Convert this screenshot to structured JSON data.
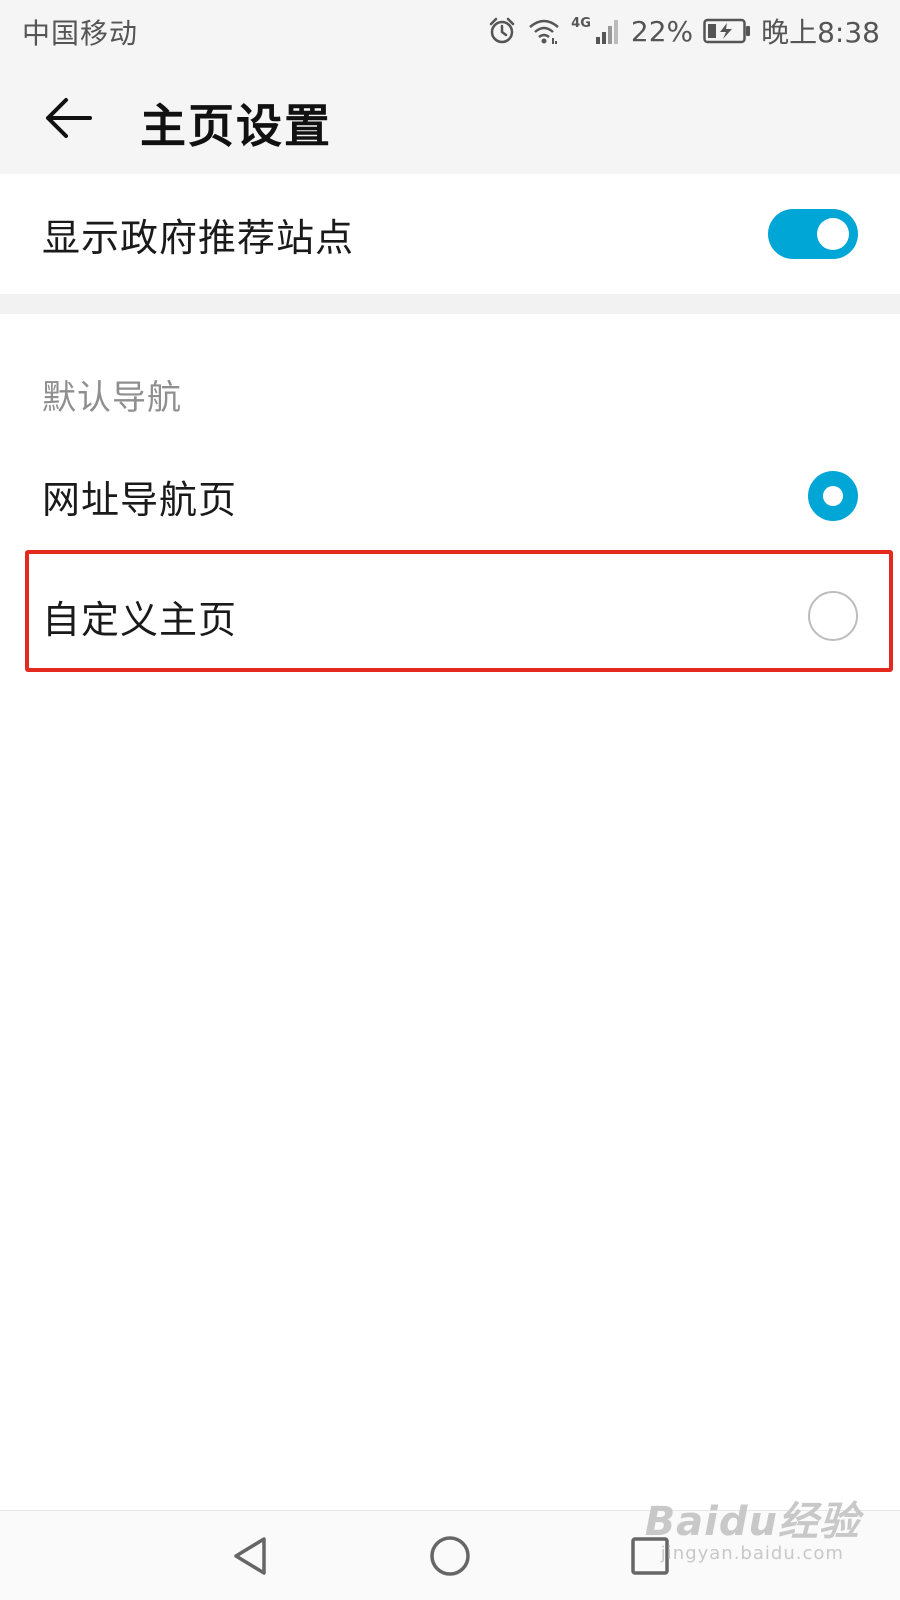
{
  "status_bar": {
    "carrier": "中国移动",
    "network_type": "4G",
    "battery_percent": "22%",
    "time": "晚上8:38",
    "icons": [
      "alarm-icon",
      "wifi-icon",
      "signal-icon",
      "battery-charging-icon"
    ]
  },
  "app_bar": {
    "title": "主页设置",
    "back_icon": "arrow-left-icon"
  },
  "settings": {
    "show_gov_sites": {
      "label": "显示政府推荐站点",
      "enabled": true
    },
    "default_nav": {
      "header": "默认导航",
      "options": [
        {
          "label": "网址导航页",
          "selected": true
        },
        {
          "label": "自定义主页",
          "selected": false
        }
      ]
    }
  },
  "nav_bar": {
    "icons": [
      "nav-back-icon",
      "nav-home-icon",
      "nav-recent-icon"
    ]
  },
  "watermark": {
    "main": "Baidu经验",
    "sub": "jingyan.baidu.com"
  },
  "colors": {
    "accent": "#00a6d6",
    "highlight": "#e4291f",
    "header_bg": "#f5f5f5",
    "section_header": "#8f8f8f"
  }
}
